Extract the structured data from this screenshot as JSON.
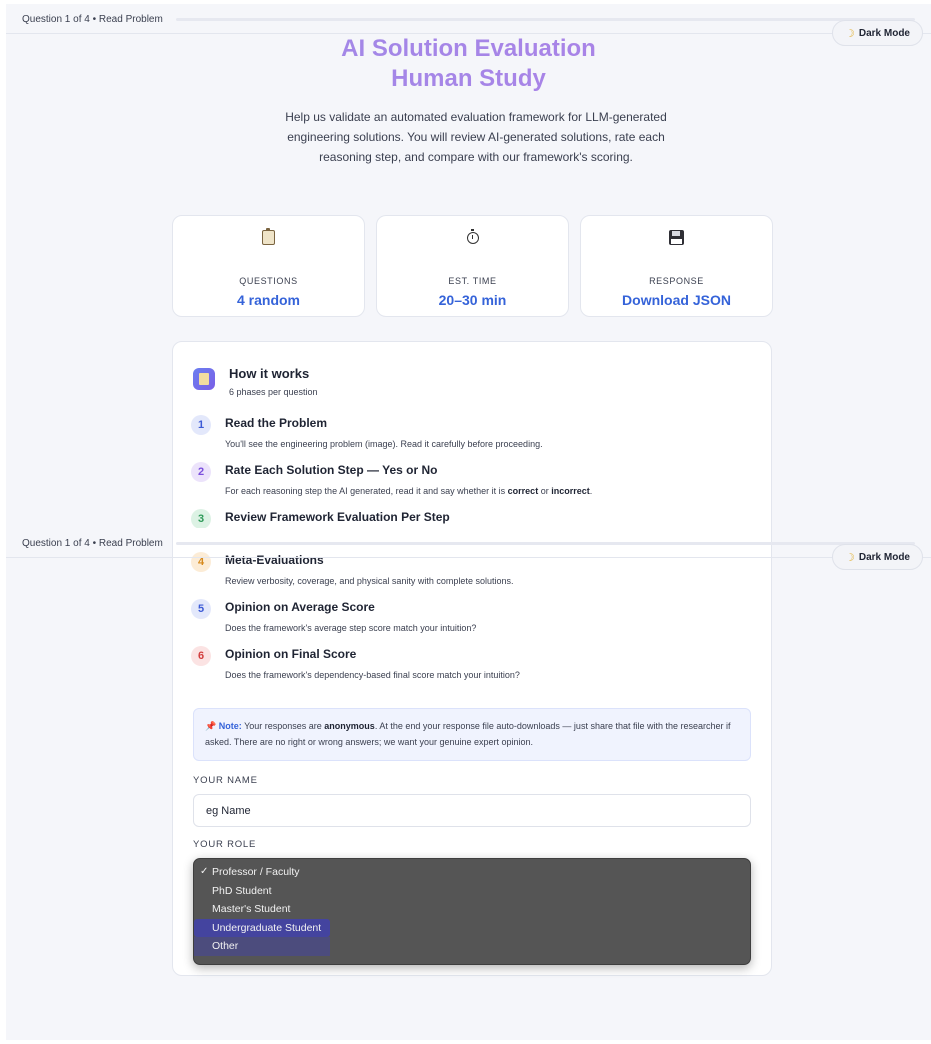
{
  "progress_label": "Question 1 of 4 • Read Problem",
  "dark_mode_label": "Dark Mode",
  "hero": {
    "title_line1": "AI Solution Evaluation",
    "title_line2": "Human Study",
    "description": "Help us validate an automated evaluation framework for LLM-generated engineering solutions. You will review AI-generated solutions, rate each reasoning step, and compare with our framework's scoring."
  },
  "stats": [
    {
      "icon": "clipboard-icon",
      "label": "QUESTIONS",
      "value": "4 random"
    },
    {
      "icon": "stopwatch-icon",
      "label": "EST. TIME",
      "value": "20–30 min"
    },
    {
      "icon": "floppy-disk-icon",
      "label": "RESPONSE",
      "value": "Download JSON"
    }
  ],
  "how_it_works": {
    "title": "How it works",
    "subtitle": "6 phases per question",
    "steps": [
      {
        "num": "1",
        "title": "Read the Problem",
        "desc": "You'll see the engineering problem (image). Read it carefully before proceeding."
      },
      {
        "num": "2",
        "title": "Rate Each Solution Step — Yes or No",
        "desc_before": "For each reasoning step the AI generated, read it and say whether it is ",
        "desc_bold1": "correct",
        "desc_mid": " or ",
        "desc_bold2": "incorrect",
        "desc_after": "."
      },
      {
        "num": "3",
        "title": "Review Framework Evaluation Per Step"
      },
      {
        "num": "4",
        "title": "Meta-Evaluations",
        "desc": "Review verbosity, coverage, and physical sanity with complete solutions."
      },
      {
        "num": "5",
        "title": "Opinion on Average Score",
        "desc": "Does the framework's average step score match your intuition?"
      },
      {
        "num": "6",
        "title": "Opinion on Final Score",
        "desc": "Does the framework's dependency-based final score match your intuition?"
      }
    ]
  },
  "note": {
    "label": "Note:",
    "text_before": " Your responses are ",
    "bold": "anonymous",
    "text_after": ". At the end your response file auto-downloads — just share that file with the researcher if asked. There are no right or wrong answers; we want your genuine expert opinion."
  },
  "form": {
    "name_label": "YOUR NAME",
    "name_value": "eg Name",
    "role_label": "YOUR ROLE",
    "role_options": [
      "Professor / Faculty",
      "PhD Student",
      "Master's Student",
      "Undergraduate Student",
      "Other"
    ],
    "role_selected": "Professor / Faculty",
    "role_hovered": "Undergraduate Student"
  },
  "colors": {
    "accent": "#3563d9",
    "title_gradient_start": "#9c8ce8",
    "title_gradient_end": "#b07fe6",
    "background": "#f5f6fa",
    "dropdown_bg": "#555555"
  }
}
